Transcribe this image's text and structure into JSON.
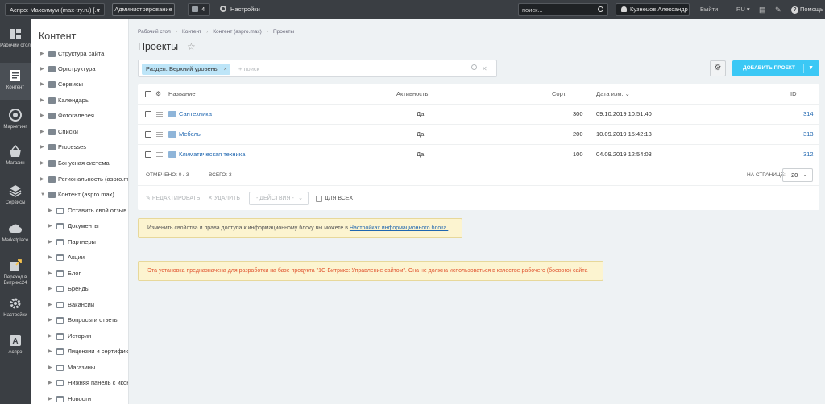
{
  "topbar": {
    "site_select": "Аспро: Максимум (max-try.ru) [...",
    "admin_label": "Администрирование",
    "notifications_count": "4",
    "settings_label": "Настройки",
    "search_placeholder": "поиск...",
    "user_name": "Кузнецов Александр",
    "logout_label": "Выйти",
    "lang": "RU",
    "help_label": "Помощь"
  },
  "iconbar": [
    {
      "label": "Рабочий стол",
      "icon": "desktop-icon"
    },
    {
      "label": "Контент",
      "icon": "content-icon"
    },
    {
      "label": "Маркетинг",
      "icon": "marketing-icon"
    },
    {
      "label": "Магазин",
      "icon": "shop-icon"
    },
    {
      "label": "Сервисы",
      "icon": "services-icon"
    },
    {
      "label": "Marketplace",
      "icon": "marketplace-icon"
    },
    {
      "label": "Переход в Битрикс24",
      "icon": "bitrix24-icon"
    },
    {
      "label": "Настройки",
      "icon": "settings-icon"
    },
    {
      "label": "Аспро",
      "icon": "aspro-icon"
    }
  ],
  "menu": {
    "title": "Контент",
    "items": [
      {
        "label": "Структура сайта"
      },
      {
        "label": "Оргструктура"
      },
      {
        "label": "Сервисы"
      },
      {
        "label": "Календарь"
      },
      {
        "label": "Фотогалерея"
      },
      {
        "label": "Списки"
      },
      {
        "label": "Processes"
      },
      {
        "label": "Бонусная система"
      },
      {
        "label": "Региональность (aspro.max)"
      },
      {
        "label": "Контент (aspro.max)"
      }
    ],
    "subitems": [
      {
        "label": "Оставить свой отзыв"
      },
      {
        "label": "Документы"
      },
      {
        "label": "Партнеры"
      },
      {
        "label": "Акции"
      },
      {
        "label": "Блог"
      },
      {
        "label": "Бренды"
      },
      {
        "label": "Вакансии"
      },
      {
        "label": "Вопросы и ответы"
      },
      {
        "label": "Истории"
      },
      {
        "label": "Лицензии и сертификаты"
      },
      {
        "label": "Магазины"
      },
      {
        "label": "Нижняя панель с иконками"
      },
      {
        "label": "Новости"
      }
    ]
  },
  "breadcrumbs": [
    "Рабочий стол",
    "Контент",
    "Контент (aspro.max)",
    "Проекты"
  ],
  "page_title": "Проекты",
  "filter": {
    "chip": "Раздел: Верхний уровень",
    "add_placeholder": "+ поиск"
  },
  "add_button": "ДОБАВИТЬ ПРОЕКТ",
  "grid": {
    "columns": {
      "name": "Название",
      "active": "Активность",
      "sort": "Сорт.",
      "date": "Дата изм.",
      "id": "ID"
    },
    "rows": [
      {
        "name": "Сантехника",
        "active": "Да",
        "sort": "300",
        "date": "09.10.2019 10:51:40",
        "id": "314"
      },
      {
        "name": "Мебель",
        "active": "Да",
        "sort": "200",
        "date": "10.09.2019 15:42:13",
        "id": "313"
      },
      {
        "name": "Климатическая техника",
        "active": "Да",
        "sort": "100",
        "date": "04.09.2019 12:54:03",
        "id": "312"
      }
    ],
    "selected_label": "ОТМЕЧЕНО: 0 / 3",
    "total_label": "ВСЕГО: 3",
    "per_page_label": "НА СТРАНИЦЕ:",
    "per_page_value": "20"
  },
  "actions": {
    "edit": "РЕДАКТИРОВАТЬ",
    "delete": "УДАЛИТЬ",
    "select": "- ДЕЙСТВИЯ -",
    "for_all": "ДЛЯ ВСЕХ"
  },
  "notes": {
    "info_text": "Изменить свойства и права доступа к информационному блоку вы можете в ",
    "info_link": "Настройках информационного блока.",
    "warning": "Эта установка предназначена для разработки на базе продукта \"1С-Битрикс: Управление сайтом\". Она не должна использоваться в качестве рабочего (боевого) сайта"
  }
}
